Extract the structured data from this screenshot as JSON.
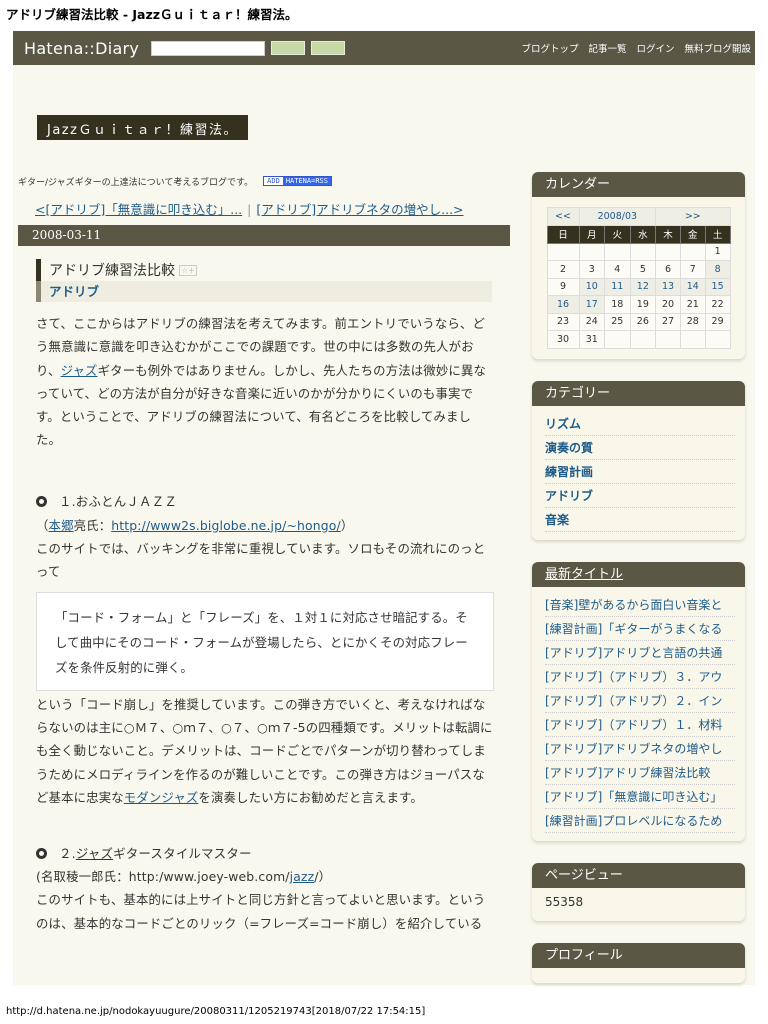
{
  "page_title": "アドリブ練習法比較 - JazzＧｕｉｔａｒ！練習法。",
  "header": {
    "logo": "Hatena::Diary",
    "nav": [
      "ブログトップ",
      "記事一覧",
      "ログイン",
      "無料ブログ開設"
    ]
  },
  "blog_title": "JazzＧｕｉｔａｒ！練習法。",
  "description": "ギター/ジャズギターの上達法について考えるブログです。",
  "rss": {
    "add": "ADD",
    "label": "HATENA=RSS"
  },
  "pager": {
    "prev": "<[アドリブ]「無意識に叩き込む」...",
    "sep": "|",
    "next": "[アドリブ]アドリブネタの増やし...>"
  },
  "date": "2008-03-11",
  "entry": {
    "title": "アドリブ練習法比較",
    "star": "☆+",
    "category": "アドリブ",
    "p1a": "さて、ここからはアドリブの練習法を考えてみます。前エントリでいうなら、どう無意識に意識を叩き込むかがここでの課題です。世の中には多数の先人がおり、",
    "p1link": "ジャズ",
    "p1b": "ギターも例外ではありません。しかし、先人たちの方法は微妙に異なっていて、どの方法が自分が好きな音楽に近いのかが分かりにくいのも事実です。ということで、アドリブの練習法について、有名どころを比較してみました。",
    "s1": {
      "heading": "１.おふとんＪＡＺＺ",
      "open": "（",
      "author_link": "本郷",
      "author_rest": "亮氏：",
      "url": "http://www2s.biglobe.ne.jp/~hongo/",
      "close": "）"
    },
    "s1p": "このサイトでは、バッキングを非常に重視しています。ソロもその流れにのっとって",
    "quote": "「コード・フォーム」と「フレーズ」を、１対１に対応させ暗記する。そして曲中にそのコード・フォームが登場したら、とにかくその対応フレーズを条件反射的に弾く。",
    "s1p2a": "という「コード崩し」を推奨しています。この弾き方でいくと、考えなければならないのは主に○Ｍ７、○ｍ７、○７、○ｍ７-5の四種類です。メリットは転調にも全く動じないこと。デメリットは、コードごとでパターンが切り替わってしまうためにメロディラインを作るのが難しいことです。この弾き方はジョーパスなど基本に忠実な",
    "s1p2link": "モダンジャズ",
    "s1p2b": "を演奏したい方にお勧めだと言えます。",
    "s2": {
      "num": "２.",
      "link": "ジャズ",
      "rest": "ギタースタイルマスター",
      "src_a": "(名取稜一郎氏：http:/www.joey-web.com/",
      "src_link": "jazz",
      "src_b": "/）"
    },
    "s2p": "このサイトも、基本的には上サイトと同じ方針と言ってよいと思います。というのは、基本的なコードごとのリック（=フレーズ=コード崩し）を紹介している"
  },
  "sidebar": {
    "calendar": {
      "title": "カレンダー",
      "prev": "<<",
      "month": "2008/03",
      "next": ">>",
      "weekdays": [
        "日",
        "月",
        "火",
        "水",
        "木",
        "金",
        "土"
      ],
      "weeks": [
        [
          "",
          "",
          "",
          "",
          "",
          "",
          "1"
        ],
        [
          "2",
          "3",
          "4",
          "5",
          "6",
          "7",
          "8"
        ],
        [
          "9",
          "10",
          "11",
          "12",
          "13",
          "14",
          "15"
        ],
        [
          "16",
          "17",
          "18",
          "19",
          "20",
          "21",
          "22"
        ],
        [
          "23",
          "24",
          "25",
          "26",
          "27",
          "28",
          "29"
        ],
        [
          "30",
          "31",
          "",
          "",
          "",
          "",
          ""
        ]
      ],
      "linked": [
        "8",
        "10",
        "11",
        "12",
        "13",
        "14",
        "15",
        "16",
        "17"
      ]
    },
    "categories": {
      "title": "カテゴリー",
      "items": [
        "リズム",
        "演奏の質",
        "練習計画",
        "アドリブ",
        "音楽"
      ]
    },
    "recent": {
      "title": "最新タイトル",
      "items": [
        "[音楽]壁があるから面白い音楽と",
        "[練習計画]「ギターがうまくなる",
        "[アドリブ]アドリブと言語の共通",
        "[アドリブ]（アドリブ）３．アウ",
        "[アドリブ]（アドリブ）２．イン",
        "[アドリブ]（アドリブ）１．材料",
        "[アドリブ]アドリブネタの増やし",
        "[アドリブ]アドリブ練習法比較",
        "[アドリブ]「無意識に叩き込む」",
        "[練習計画]プロレベルになるため"
      ]
    },
    "pageview": {
      "title": "ページビュー",
      "count": "55358"
    },
    "profile": {
      "title": "プロフィール"
    }
  },
  "footer": "http://d.hatena.ne.jp/nodokayuugure/20080311/1205219743[2018/07/22 17:54:15]"
}
